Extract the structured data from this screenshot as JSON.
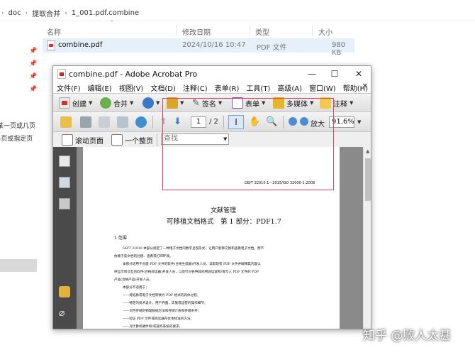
{
  "explorer": {
    "breadcrumb": [
      "doc",
      "提取合并",
      "1_001.pdf.combine"
    ],
    "columns": {
      "name": "名称",
      "modified": "修改日期",
      "type": "类型",
      "size": "大小"
    },
    "file": {
      "name": "combine.pdf",
      "modified": "2024/10/16 10:47",
      "type": "PDF 文件",
      "size": "980 KB"
    },
    "left_links": [
      "某一页或几页",
      "-页或指定页"
    ]
  },
  "acrobat": {
    "title": "combine.pdf - Adobe Acrobat Pro",
    "menu": [
      "文件(F)",
      "编辑(E)",
      "视图(V)",
      "文档(D)",
      "注释(C)",
      "表单(R)",
      "工具(T)",
      "高级(A)",
      "窗口(W)",
      "帮助(H)"
    ],
    "toolbar1": {
      "create": "创建",
      "combine": "合并",
      "sign": "签名",
      "forms": "表单",
      "multimedia": "多媒体",
      "comment": "注释"
    },
    "toolbar2": {
      "page_current": "1",
      "page_total": "/ 2",
      "zoom_in": "放大",
      "zoom_value": "91.6%"
    },
    "toolbar3": {
      "scrolling": "滚动页面",
      "single_page": "一个整页",
      "search_placeholder": "查找"
    },
    "document": {
      "header_code": "GB/T 32010.1—2015/ISO 32000-1:2008",
      "title1": "文献管理",
      "title2": "可移植文档格式　第 1 部分：PDF1.7",
      "section": "1  范围",
      "lines": [
        "GB/T 32010 本部分规定了一种电子文档的数字呈现形式，让用户能够交换和查看电子文档，而不",
        "依赖于该文档的创建、查看或打印环境。",
        "本部分适用于创建 PDF 文件的软件(合格生成器)开发人员、读取现有 PDF 文件并解释其内容以",
        "供显示和交互的软件(合格阅读器)开发人员，以及针对各种其他用途读取和/或写入 PDF 文件的 PDF",
        "产品(合格产品)开发人员。",
        "本部分不适用于：",
        "——将纸质或电子文档转换为 PDF 格式的具体过程；",
        "——特定的技术设计，用户界面，实施或运营的操作细节；",
        "——文档存储的物理数据方法和存储介质和存储条件；",
        "——验证 PDF 文件或阅读器符合本标准的方法；",
        "——对计算机硬件和/或操作系统的要求。"
      ]
    }
  },
  "watermark": "知乎 @败人太甚",
  "colors": {
    "selection_box": "#e0405a",
    "file_row_highlight": "#e5f0fb",
    "sidebar": "#4a4a4a"
  }
}
